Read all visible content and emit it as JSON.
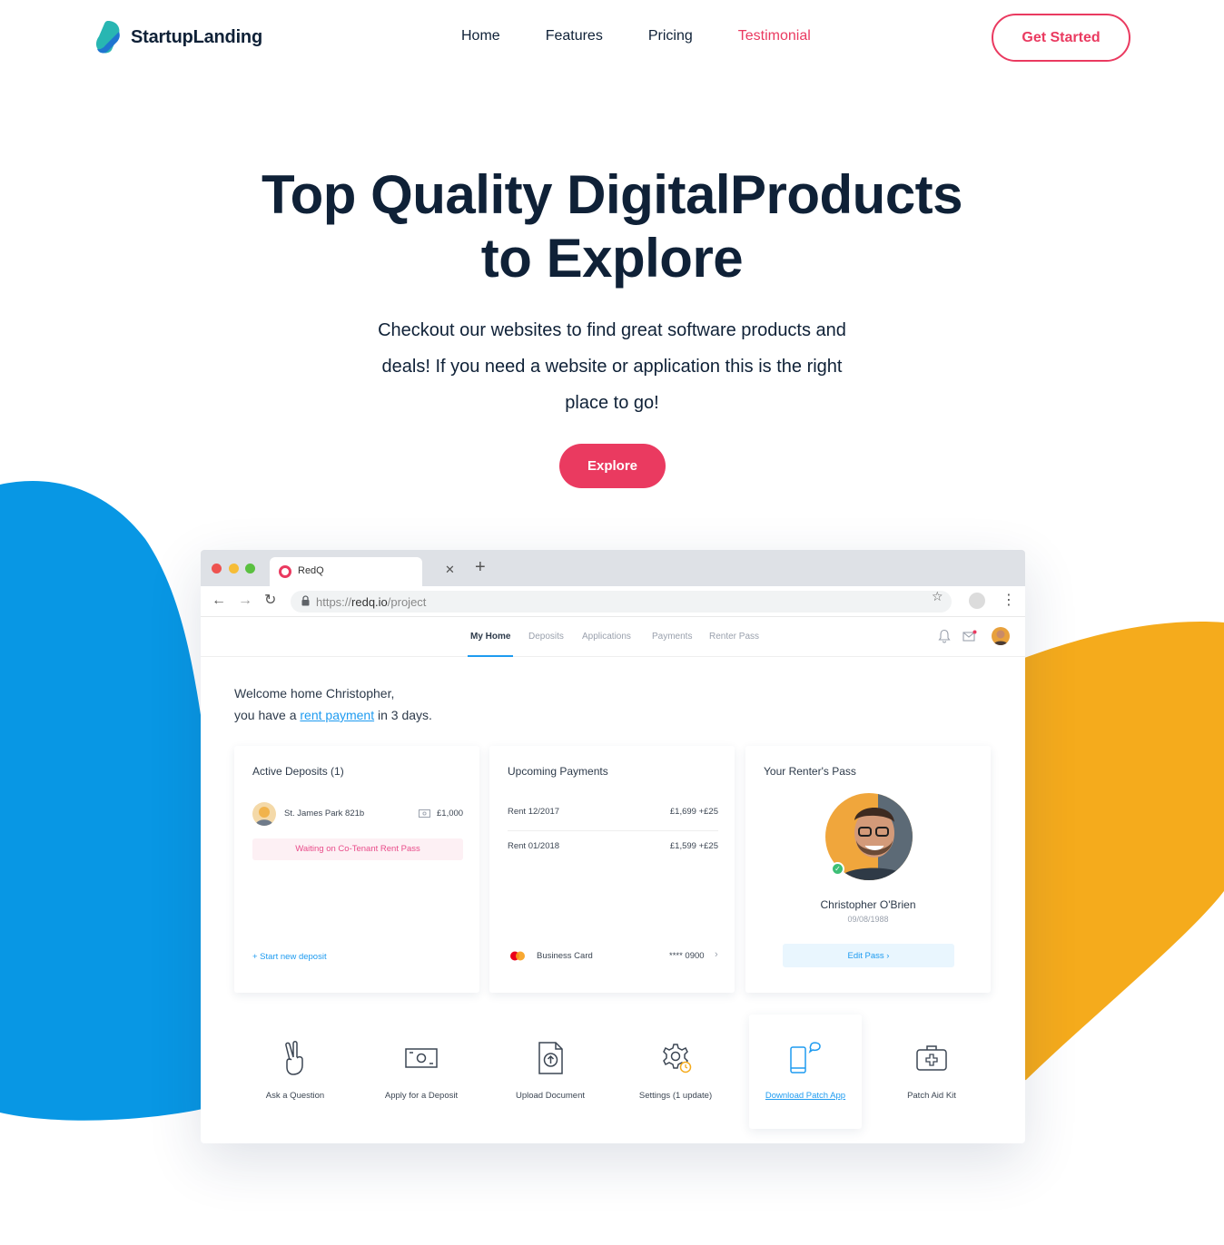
{
  "brand": {
    "name": "StartupLanding",
    "logo_colors": [
      "#28b6b2",
      "#1f75d0"
    ]
  },
  "nav": {
    "items": [
      {
        "label": "Home",
        "active": false
      },
      {
        "label": "Features",
        "active": false
      },
      {
        "label": "Pricing",
        "active": false
      },
      {
        "label": "Testimonial",
        "active": true
      }
    ],
    "cta_label": "Get Started"
  },
  "hero": {
    "title_line1": "Top Quality DigitalProducts",
    "title_line2": "to Explore",
    "description": "Checkout our websites to find great software products and deals! If you need a website or application this is the right place to go!",
    "button_label": "Explore"
  },
  "colors": {
    "accent": "#ea3a60",
    "heading": "#0f2137",
    "blue_blob": "#0897e4",
    "yellow_blob": "#f5ab1c",
    "app_link": "#1e9bf0"
  },
  "browser": {
    "tab_title": "RedQ",
    "url_prefix": "https://",
    "url_host": "redq.io",
    "url_path": "/project",
    "icons": [
      "back-arrow-icon",
      "forward-arrow-icon",
      "reload-icon",
      "lock-icon",
      "star-icon",
      "menu-dots-icon"
    ]
  },
  "app": {
    "tabs": [
      {
        "label": "My Home",
        "active": true
      },
      {
        "label": "Deposits",
        "active": false
      },
      {
        "label": "Applications",
        "active": false
      },
      {
        "label": "Payments",
        "active": false
      },
      {
        "label": "Renter Pass",
        "active": false
      }
    ],
    "welcome_line1": "Welcome home Christopher,",
    "welcome_prefix": "you have a ",
    "welcome_link": "rent payment",
    "welcome_suffix": " in 3 days.",
    "deposits": {
      "title": "Active Deposits (1)",
      "property": "St. James Park 821b",
      "amount": "£1,000",
      "status": "Waiting on Co-Tenant Rent Pass",
      "link": "+ Start new deposit"
    },
    "payments": {
      "title": "Upcoming Payments",
      "rows": [
        {
          "label": "Rent 12/2017",
          "amount": "£1,699  +£25"
        },
        {
          "label": "Rent 01/2018",
          "amount": "£1,599  +£25"
        }
      ],
      "card_name": "Business Card",
      "card_number": "**** 0900"
    },
    "pass": {
      "title": "Your Renter's Pass",
      "name": "Christopher O'Brien",
      "dob": "09/08/1988",
      "button": "Edit Pass"
    },
    "actions": [
      {
        "label": "Ask a Question",
        "icon": "peace-hand-icon"
      },
      {
        "label": "Apply for a Deposit",
        "icon": "cash-icon"
      },
      {
        "label": "Upload Document",
        "icon": "upload-document-icon"
      },
      {
        "label": "Settings (1 update)",
        "icon": "gear-icon"
      },
      {
        "label": "Download Patch App",
        "icon": "devices-icon"
      },
      {
        "label": "Patch Aid Kit",
        "icon": "first-aid-kit-icon"
      }
    ]
  }
}
